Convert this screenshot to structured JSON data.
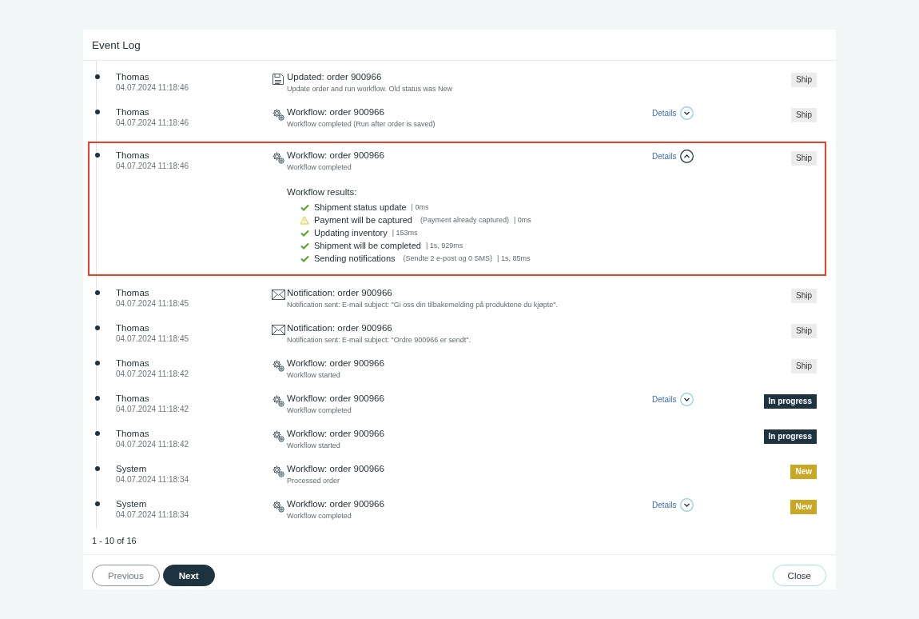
{
  "title": "Event Log",
  "entries": [
    {
      "user": "Thomas",
      "time": "04.07.2024 11:18:46",
      "kind": "save",
      "title": "Updated: order 900966",
      "description": "Update order and run workflow. Old status was New",
      "status": {
        "label": "Ship",
        "kind": "ship"
      },
      "highlighted": false
    },
    {
      "user": "Thomas",
      "time": "04.07.2024 11:18:46",
      "kind": "workflow",
      "title": "Workflow: order 900966",
      "description": "Workflow completed (Run after order is saved)",
      "details": {
        "label": "Details",
        "expanded": false
      },
      "status": {
        "label": "Ship",
        "kind": "ship"
      },
      "highlighted": false
    },
    {
      "user": "Thomas",
      "time": "04.07.2024 11:18:46",
      "kind": "workflow",
      "title": "Workflow: order 900966",
      "description": "Workflow completed",
      "details": {
        "label": "Details",
        "expanded": true
      },
      "status": {
        "label": "Ship",
        "kind": "ship"
      },
      "highlighted": true,
      "results": {
        "heading": "Workflow results:",
        "items": [
          {
            "kind": "ok",
            "name": "Shipment status update",
            "duration": "| 0ms"
          },
          {
            "kind": "warning",
            "name": "Payment will be captured",
            "note": "(Payment already captured)",
            "duration": "| 0ms"
          },
          {
            "kind": "ok",
            "name": "Updating inventory",
            "duration": "| 153ms"
          },
          {
            "kind": "ok",
            "name": "Shipment will be completed",
            "duration": "| 1s, 929ms"
          },
          {
            "kind": "ok",
            "name": "Sending notifications",
            "note": "(Sendte 2 e-post og 0 SMS)",
            "duration": "| 1s, 85ms"
          }
        ]
      }
    },
    {
      "user": "Thomas",
      "time": "04.07.2024 11:18:45",
      "kind": "mail",
      "title": "Notification: order 900966",
      "description": "Notification sent: E-mail subject: \"Gi oss din tilbakemelding på produktene du kjøpte\".",
      "status": {
        "label": "Ship",
        "kind": "ship"
      },
      "highlighted": false
    },
    {
      "user": "Thomas",
      "time": "04.07.2024 11:18:45",
      "kind": "mail",
      "title": "Notification: order 900966",
      "description": "Notification sent: E-mail subject: \"Ordre 900966 er sendt\".",
      "status": {
        "label": "Ship",
        "kind": "ship"
      },
      "highlighted": false
    },
    {
      "user": "Thomas",
      "time": "04.07.2024 11:18:42",
      "kind": "workflow",
      "title": "Workflow: order 900966",
      "description": "Workflow started",
      "status": {
        "label": "Ship",
        "kind": "ship"
      },
      "highlighted": false
    },
    {
      "user": "Thomas",
      "time": "04.07.2024 11:18:42",
      "kind": "workflow",
      "title": "Workflow: order 900966",
      "description": "Workflow completed",
      "details": {
        "label": "Details",
        "expanded": false
      },
      "status": {
        "label": "In progress",
        "kind": "progress"
      },
      "highlighted": false
    },
    {
      "user": "Thomas",
      "time": "04.07.2024 11:18:42",
      "kind": "workflow",
      "title": "Workflow: order 900966",
      "description": "Workflow started",
      "status": {
        "label": "In progress",
        "kind": "progress"
      },
      "highlighted": false
    },
    {
      "user": "System",
      "time": "04.07.2024 11:18:34",
      "kind": "workflow",
      "title": "Workflow: order 900966",
      "description": "Processed order",
      "status": {
        "label": "New",
        "kind": "new"
      },
      "highlighted": false
    },
    {
      "user": "System",
      "time": "04.07.2024 11:18:34",
      "kind": "workflow",
      "title": "Workflow: order 900966",
      "description": "Workflow completed",
      "details": {
        "label": "Details",
        "expanded": false
      },
      "status": {
        "label": "New",
        "kind": "new"
      },
      "highlighted": false
    }
  ],
  "pagination": "1 - 10 of 16",
  "buttons": [
    {
      "label": "Previous",
      "kind": "secondary"
    },
    {
      "label": "Next",
      "kind": "primary"
    },
    {
      "label": "Close",
      "kind": "close"
    }
  ]
}
